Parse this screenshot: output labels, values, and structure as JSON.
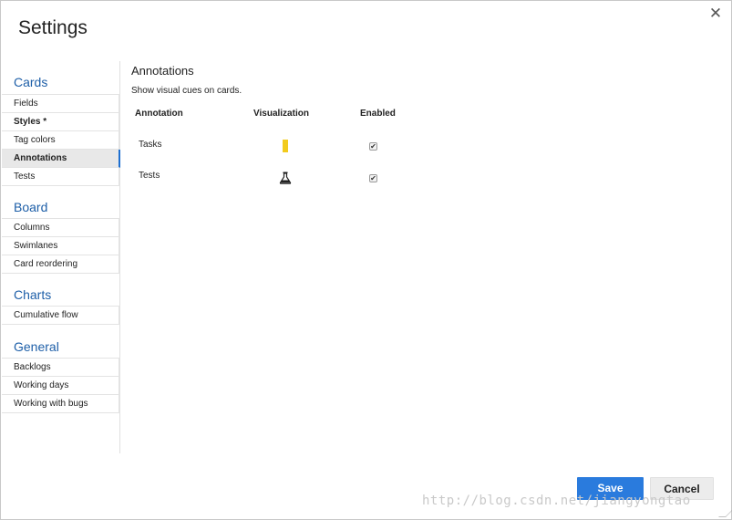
{
  "dialog": {
    "title": "Settings",
    "close_icon": "close-icon"
  },
  "sidebar": {
    "groups": [
      {
        "heading": "Cards",
        "items": [
          {
            "label": "Fields"
          },
          {
            "label": "Styles *"
          },
          {
            "label": "Tag colors"
          },
          {
            "label": "Annotations",
            "active": true
          },
          {
            "label": "Tests"
          }
        ]
      },
      {
        "heading": "Board",
        "items": [
          {
            "label": "Columns"
          },
          {
            "label": "Swimlanes"
          },
          {
            "label": "Card reordering"
          }
        ]
      },
      {
        "heading": "Charts",
        "items": [
          {
            "label": "Cumulative flow"
          }
        ]
      },
      {
        "heading": "General",
        "items": [
          {
            "label": "Backlogs"
          },
          {
            "label": "Working days"
          },
          {
            "label": "Working with bugs"
          }
        ]
      }
    ]
  },
  "main": {
    "section_title": "Annotations",
    "description": "Show visual cues on cards.",
    "table": {
      "headers": [
        "Annotation",
        "Visualization",
        "Enabled"
      ],
      "rows": [
        {
          "name": "Tasks",
          "visualization": "yellow-bar-icon",
          "enabled": true
        },
        {
          "name": "Tests",
          "visualization": "flask-icon",
          "enabled": true
        }
      ]
    }
  },
  "footer": {
    "save_label": "Save",
    "cancel_label": "Cancel"
  },
  "watermark": "http://blog.csdn.net/jiangyongtao",
  "colors": {
    "accent": "#2a7bdd",
    "heading_blue": "#1e5fa8",
    "tasks_bar": "#f2cb1d"
  }
}
